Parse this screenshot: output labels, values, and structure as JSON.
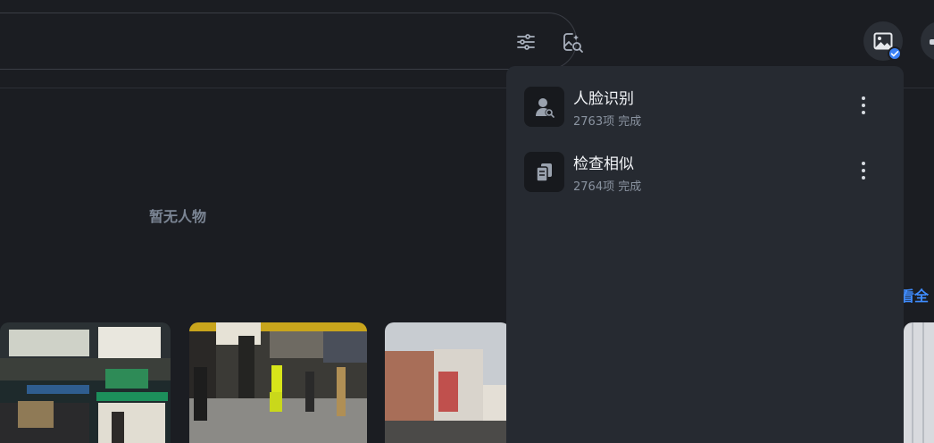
{
  "search": {
    "filter_icon": "sliders-icon",
    "image_search_icon": "image-search-icon"
  },
  "header": {
    "active_icon": "image-icon",
    "active_badge_icon": "check-icon"
  },
  "people": {
    "empty_text": "暂无人物"
  },
  "section": {
    "view_all_label": "看全"
  },
  "tasks_panel": {
    "items": [
      {
        "icon": "face-search-icon",
        "title": "人脸识别",
        "subtitle": "2763项 完成"
      },
      {
        "icon": "copy-documents-icon",
        "title": "检查相似",
        "subtitle": "2764项 完成"
      }
    ]
  }
}
